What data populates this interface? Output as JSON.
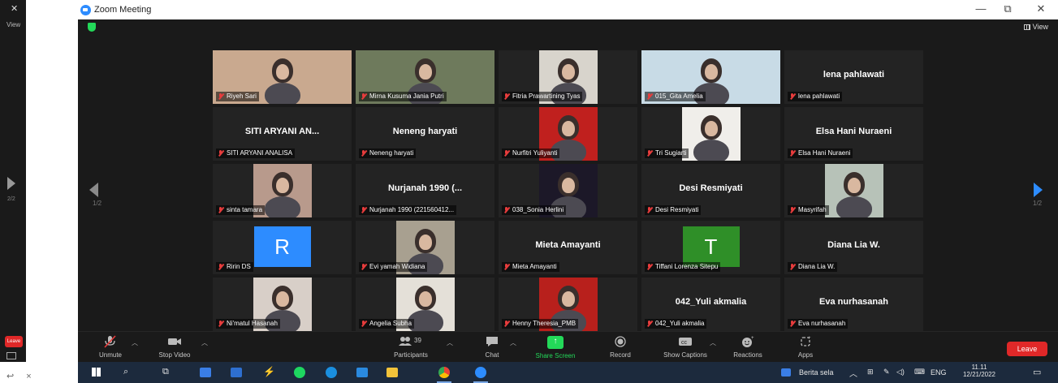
{
  "window": {
    "title": "Zoom Meeting",
    "view_label": "View",
    "minimize": "—",
    "restore": "⧉",
    "close": "✕"
  },
  "background_window": {
    "close": "✕",
    "view": "View",
    "page": "2/2",
    "leave": "Leave"
  },
  "pagination": {
    "left": "1/2",
    "right": "1/2"
  },
  "participants": [
    {
      "name": "Riyeh Sari",
      "type": "video",
      "bg": "#c9a98f",
      "active": true
    },
    {
      "name": "Mirna Kusuma Jania Putri",
      "type": "video",
      "bg": "#6e7a5c"
    },
    {
      "name": "Fitria Prawartining Tyas",
      "type": "video",
      "bg": "#d8d4cc"
    },
    {
      "name": "015_Gita Amelia",
      "type": "video",
      "bg": "#c8dbe6"
    },
    {
      "name": "lena pahlawati",
      "type": "name",
      "display": "lena pahlawati"
    },
    {
      "name": "SITI ARYANI ANALISA",
      "type": "name",
      "display": "SITI ARYANI AN..."
    },
    {
      "name": "Neneng haryati",
      "type": "name",
      "display": "Neneng haryati"
    },
    {
      "name": "Nurfitri Yuliyanti",
      "type": "video",
      "bg": "#c0201e"
    },
    {
      "name": "Tri Sugiarti",
      "type": "video",
      "bg": "#f0eeea"
    },
    {
      "name": "Elsa Hani Nuraeni",
      "type": "name",
      "display": "Elsa Hani Nuraeni"
    },
    {
      "name": "sinta tamara",
      "type": "video",
      "bg": "#b89a8c"
    },
    {
      "name": "Nurjanah 1990 (221560412...",
      "type": "name",
      "display": "Nurjanah 1990 (..."
    },
    {
      "name": "038_Sonia Herlini",
      "type": "video",
      "bg": "#1c1828"
    },
    {
      "name": "Desi Resmiyati",
      "type": "name",
      "display": "Desi Resmiyati"
    },
    {
      "name": "Masyrifah",
      "type": "video",
      "bg": "#b7c2b8"
    },
    {
      "name": "Ririn DS",
      "type": "letter",
      "letter": "R",
      "bg": "#2d8cff"
    },
    {
      "name": "Evi yamah Widiana",
      "type": "video",
      "bg": "#a8a090"
    },
    {
      "name": "Mieta Amayanti",
      "type": "name",
      "display": "Mieta Amayanti"
    },
    {
      "name": "Tiffani Lorenza Sitepu",
      "type": "letter",
      "letter": "T",
      "bg": "#2f8f28"
    },
    {
      "name": "Diana Lia W.",
      "type": "name",
      "display": "Diana Lia W."
    },
    {
      "name": "Ni'matul Hasanah",
      "type": "video",
      "bg": "#d8cfc8"
    },
    {
      "name": "Angelia Subha",
      "type": "video",
      "bg": "#e4e0d8"
    },
    {
      "name": "Henny Theresia_PMB",
      "type": "video",
      "bg": "#b8201c"
    },
    {
      "name": "042_Yuli akmalia",
      "type": "name",
      "display": "042_Yuli akmalia"
    },
    {
      "name": "Eva nurhasanah",
      "type": "name",
      "display": "Eva nurhasanah"
    }
  ],
  "toolbar": {
    "unmute": "Unmute",
    "stop_video": "Stop Video",
    "participants": "Participants",
    "participants_count": "39",
    "chat": "Chat",
    "share_screen": "Share Screen",
    "record": "Record",
    "show_captions": "Show Captions",
    "reactions": "Reactions",
    "apps": "Apps",
    "leave": "Leave"
  },
  "taskbar": {
    "news": "Berita sela",
    "lang": "ENG",
    "time": "11.11",
    "date": "12/21/2022"
  },
  "colors": {
    "zoom_blue": "#2d8cff",
    "share_green": "#23d959",
    "leave_red": "#e02828",
    "active_speaker": "#d6e23a"
  }
}
